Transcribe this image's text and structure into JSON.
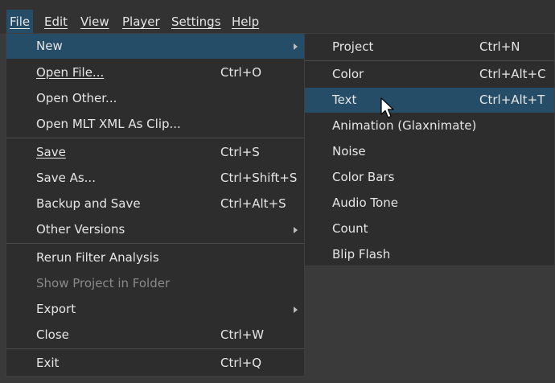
{
  "menubar": {
    "items": [
      "File",
      "Edit",
      "View",
      "Player",
      "Settings",
      "Help"
    ]
  },
  "file_menu": {
    "items": [
      {
        "label": "New",
        "shortcut": "",
        "submenu": true
      },
      {
        "label": "Open File...",
        "shortcut": "Ctrl+O"
      },
      {
        "label": "Open Other...",
        "shortcut": ""
      },
      {
        "label": "Open MLT XML As Clip...",
        "shortcut": ""
      },
      {
        "label": "Save",
        "shortcut": "Ctrl+S"
      },
      {
        "label": "Save As...",
        "shortcut": "Ctrl+Shift+S"
      },
      {
        "label": "Backup and Save",
        "shortcut": "Ctrl+Alt+S"
      },
      {
        "label": "Other Versions",
        "shortcut": "",
        "submenu": true
      },
      {
        "label": "Rerun Filter Analysis",
        "shortcut": ""
      },
      {
        "label": "Show Project in Folder",
        "shortcut": "",
        "disabled": true
      },
      {
        "label": "Export",
        "shortcut": "",
        "submenu": true
      },
      {
        "label": "Close",
        "shortcut": "Ctrl+W"
      },
      {
        "label": "Exit",
        "shortcut": "Ctrl+Q"
      }
    ]
  },
  "new_submenu": {
    "items": [
      {
        "label": "Project",
        "shortcut": "Ctrl+N"
      },
      {
        "label": "Color",
        "shortcut": "Ctrl+Alt+C"
      },
      {
        "label": "Text",
        "shortcut": "Ctrl+Alt+T"
      },
      {
        "label": "Animation (Glaxnimate)",
        "shortcut": ""
      },
      {
        "label": "Noise",
        "shortcut": ""
      },
      {
        "label": "Color Bars",
        "shortcut": ""
      },
      {
        "label": "Audio Tone",
        "shortcut": ""
      },
      {
        "label": "Count",
        "shortcut": ""
      },
      {
        "label": "Blip Flash",
        "shortcut": ""
      }
    ]
  },
  "colors": {
    "highlight": "#264d68",
    "menu_bg": "#2d2d2d",
    "background": "#3a3a3a"
  }
}
